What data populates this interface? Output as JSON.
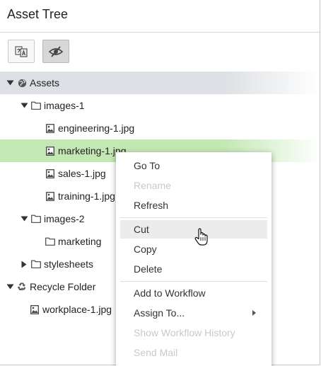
{
  "panel": {
    "title": "Asset Tree"
  },
  "toolbar": {
    "buttons": [
      {
        "icon": "translate-icon",
        "active": false
      },
      {
        "icon": "eye-slash-icon",
        "active": true
      }
    ]
  },
  "tree": {
    "nodes": [
      {
        "label": "Assets",
        "icon": "globe-icon",
        "caret": "expanded",
        "level": 0,
        "highlight": "root"
      },
      {
        "label": "images-1",
        "icon": "folder-icon",
        "caret": "expanded",
        "level": 1
      },
      {
        "label": "engineering-1.jpg",
        "icon": "image-file-icon",
        "caret": "none",
        "level": 2
      },
      {
        "label": "marketing-1.jpg",
        "icon": "image-file-icon",
        "caret": "none",
        "level": 2,
        "highlight": "selected"
      },
      {
        "label": "sales-1.jpg",
        "icon": "image-file-icon",
        "caret": "none",
        "level": 2
      },
      {
        "label": "training-1.jpg",
        "icon": "image-file-icon",
        "caret": "none",
        "level": 2
      },
      {
        "label": "images-2",
        "icon": "folder-icon",
        "caret": "expanded",
        "level": 1
      },
      {
        "label": "marketing",
        "icon": "folder-icon",
        "caret": "none",
        "level": 2
      },
      {
        "label": "stylesheets",
        "icon": "folder-icon",
        "caret": "collapsed",
        "level": 1
      },
      {
        "label": "Recycle Folder",
        "icon": "recycle-icon",
        "caret": "expanded",
        "level": 0
      },
      {
        "label": "workplace-1.jpg",
        "icon": "image-file-icon",
        "caret": "none",
        "level": 1
      }
    ]
  },
  "context_menu": {
    "items": [
      {
        "label": "Go To",
        "disabled": false
      },
      {
        "label": "Rename",
        "disabled": true
      },
      {
        "label": "Refresh",
        "disabled": false
      },
      {
        "label": "Cut",
        "disabled": false,
        "hover": true
      },
      {
        "label": "Copy",
        "disabled": false
      },
      {
        "label": "Delete",
        "disabled": false
      },
      {
        "label": "Add to Workflow",
        "disabled": false
      },
      {
        "label": "Assign To...",
        "disabled": false,
        "submenu": true
      },
      {
        "label": "Show Workflow History",
        "disabled": true
      },
      {
        "label": "Send Mail",
        "disabled": true
      }
    ]
  },
  "colors": {
    "selected_row": "#c3e8b3",
    "root_row": "#dde0e4",
    "disabled_text": "#c9c9c9"
  }
}
